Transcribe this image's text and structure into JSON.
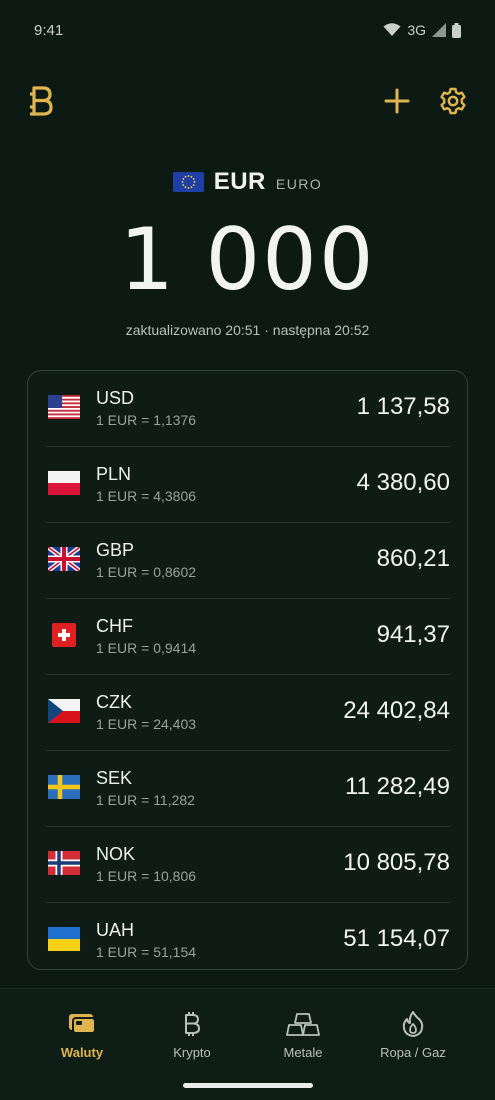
{
  "status": {
    "time": "9:41",
    "network": "3G"
  },
  "colors": {
    "background": "#0d1a14",
    "accent": "#e0b44e",
    "card_border": "#2f4238"
  },
  "header": {
    "logo_icon": "b-logo-icon",
    "add_icon": "plus-icon",
    "settings_icon": "gear-icon"
  },
  "base": {
    "code": "EUR",
    "name": "EURO",
    "amount": "1 000",
    "updated": "zaktualizowano 20:51 · następna 20:52"
  },
  "rates": [
    {
      "code": "USD",
      "rate": "1 EUR = 1,1376",
      "value": "1 137,58",
      "flag": "flag-us-icon"
    },
    {
      "code": "PLN",
      "rate": "1 EUR = 4,3806",
      "value": "4 380,60",
      "flag": "flag-pl-icon"
    },
    {
      "code": "GBP",
      "rate": "1 EUR = 0,8602",
      "value": "860,21",
      "flag": "flag-gb-icon"
    },
    {
      "code": "CHF",
      "rate": "1 EUR = 0,9414",
      "value": "941,37",
      "flag": "flag-ch-icon"
    },
    {
      "code": "CZK",
      "rate": "1 EUR = 24,403",
      "value": "24 402,84",
      "flag": "flag-cz-icon"
    },
    {
      "code": "SEK",
      "rate": "1 EUR = 11,282",
      "value": "11 282,49",
      "flag": "flag-se-icon"
    },
    {
      "code": "NOK",
      "rate": "1 EUR = 10,806",
      "value": "10 805,78",
      "flag": "flag-no-icon"
    },
    {
      "code": "UAH",
      "rate": "1 EUR = 51,154",
      "value": "51 154,07",
      "flag": "flag-ua-icon"
    }
  ],
  "nav": {
    "items": [
      {
        "label": "Waluty",
        "icon": "wallet-icon",
        "active": true
      },
      {
        "label": "Krypto",
        "icon": "bitcoin-icon",
        "active": false
      },
      {
        "label": "Metale",
        "icon": "gold-bars-icon",
        "active": false
      },
      {
        "label": "Ropa / Gaz",
        "icon": "flame-icon",
        "active": false
      }
    ]
  }
}
